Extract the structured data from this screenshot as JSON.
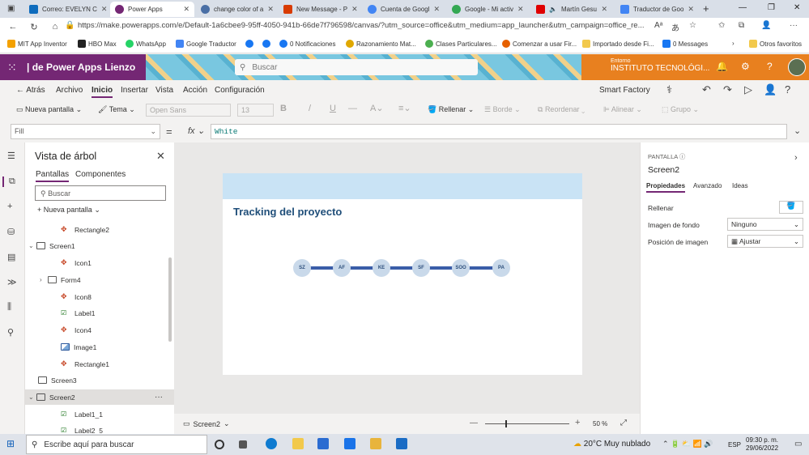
{
  "browser": {
    "tabs": [
      {
        "title": "Correo: EVELYN C",
        "color": "#0f6cbd"
      },
      {
        "title": "Power Apps",
        "color": "#742774"
      },
      {
        "title": "change color of a",
        "color": "#4a6fa5"
      },
      {
        "title": "New Message - P",
        "color": "#d83b01"
      },
      {
        "title": "Cuenta de Googl",
        "color": "#4285f4"
      },
      {
        "title": "Google - Mi activ",
        "color": "#34a853"
      },
      {
        "title": "Martín Gesu",
        "color": "#e00000"
      },
      {
        "title": "Traductor de Goo",
        "color": "#4285f4"
      }
    ],
    "new_tab": "+",
    "url": "https://make.powerapps.com/e/Default-1a6cbee9-95ff-4050-941b-66de7f796598/canvas/?utm_source=office&utm_medium=app_launcher&utm_campaign=office_re...",
    "bookmarks": [
      {
        "label": "MIT App Inventor",
        "color": "#f4a100"
      },
      {
        "label": "HBO Max",
        "color": "#222222"
      },
      {
        "label": "WhatsApp",
        "color": "#25d366"
      },
      {
        "label": "Google Traductor",
        "color": "#4285f4"
      },
      {
        "label": "",
        "color": "#1877f2"
      },
      {
        "label": "",
        "color": "#1877f2"
      },
      {
        "label": "0 Notificaciones",
        "color": "#1877f2"
      },
      {
        "label": "Razonamiento Mat...",
        "color": "#e0a800"
      },
      {
        "label": "Clases Particulares...",
        "color": "#4caf50"
      },
      {
        "label": "Comenzar a usar Fir...",
        "color": "#e66000"
      },
      {
        "label": "Importado desde Fi...",
        "color": "#f2c94c"
      },
      {
        "label": "0 Messages",
        "color": "#1877f2"
      },
      {
        "label": "Otros favoritos",
        "color": "#f2c94c"
      }
    ]
  },
  "powerapps": {
    "title": "| de Power Apps Lienzo",
    "search_placeholder": "Buscar",
    "env_label": "Entorno",
    "env_name": "INSTITUTO TECNOLÓGI..."
  },
  "menu": {
    "back": "Atrás",
    "items": [
      "Archivo",
      "Inicio",
      "Insertar",
      "Vista",
      "Acción",
      "Configuración"
    ],
    "factory": "Smart Factory"
  },
  "commands": {
    "new_screen": "Nueva pantalla",
    "theme": "Tema",
    "font": "Open Sans",
    "font_size": "13",
    "bold": "B",
    "italic": "/",
    "underline": "U",
    "strike": "—",
    "fill": "Rellenar",
    "border": "Borde",
    "reorder": "Reordenar",
    "align": "Alinear",
    "group": "Grupo"
  },
  "formula": {
    "property": "Fill",
    "eq": "=",
    "fx": "fx",
    "value": "White"
  },
  "tree": {
    "title": "Vista de árbol",
    "tabs": [
      "Pantallas",
      "Componentes"
    ],
    "search_placeholder": "Buscar",
    "new_screen": "Nueva pantalla",
    "nodes": [
      {
        "label": "Rectangle2",
        "type": "ico"
      },
      {
        "label": "Screen1",
        "type": "screen"
      },
      {
        "label": "Icon1",
        "type": "ico"
      },
      {
        "label": "Form4",
        "type": "frm"
      },
      {
        "label": "Icon8",
        "type": "ico"
      },
      {
        "label": "Label1",
        "type": "lbl"
      },
      {
        "label": "Icon4",
        "type": "ico"
      },
      {
        "label": "Image1",
        "type": "img"
      },
      {
        "label": "Rectangle1",
        "type": "ico"
      },
      {
        "label": "Screen3",
        "type": "screen"
      },
      {
        "label": "Screen2",
        "type": "screen"
      },
      {
        "label": "Label1_1",
        "type": "lbl"
      },
      {
        "label": "Label2_5",
        "type": "lbl"
      }
    ],
    "more": "···"
  },
  "canvas": {
    "title": "Tracking del proyecto",
    "dots": [
      "SZ",
      "AF",
      "KE",
      "SF",
      "SOO",
      "PA"
    ]
  },
  "status": {
    "screen": "Screen2",
    "minus": "—",
    "plus": "+",
    "zoom": "50 %"
  },
  "properties": {
    "type": "PANTALLA",
    "name": "Screen2",
    "tabs": [
      "Propiedades",
      "Avanzado",
      "Ideas"
    ],
    "rows": [
      {
        "label": "Rellenar",
        "value": ""
      },
      {
        "label": "Imagen de fondo",
        "value": "Ninguno"
      },
      {
        "label": "Posición de imagen",
        "value": "Ajustar"
      }
    ]
  },
  "taskbar": {
    "search": "Escribe aquí para buscar",
    "weather": "20°C  Muy nublado",
    "lang": "ESP",
    "time": "09:30 p. m.",
    "date": "29/06/2022"
  }
}
